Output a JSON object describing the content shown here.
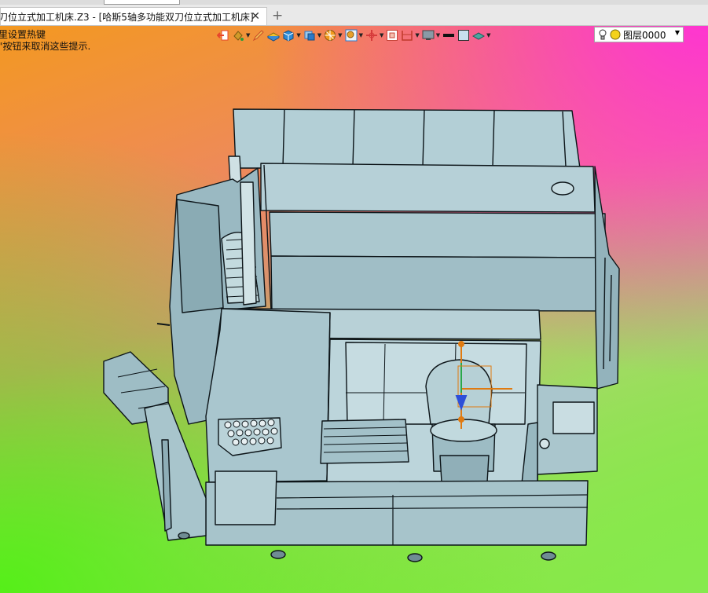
{
  "tab": {
    "title": "刀位立式加工机床.Z3 - [哈斯5轴多功能双刀位立式加工机床]",
    "close_icon": "close-icon",
    "new_tab_icon": "plus-icon"
  },
  "hint": {
    "line1": "里设置热键",
    "line2": "\"按钮来取消这些提示."
  },
  "toolbar": {
    "items": [
      {
        "icon": "exit-icon",
        "color": "#e8452c"
      },
      {
        "icon": "paint-bucket-icon",
        "color": "#d19a2a"
      },
      {
        "icon": "pencil-icon",
        "color": "#c84b2a"
      },
      {
        "icon": "flat-shade-icon",
        "color": "#f2c12e"
      },
      {
        "icon": "shaded-cube-icon",
        "color": "#2d8bd6"
      },
      {
        "icon": "view-cube-icon",
        "color": "#2b79c9"
      },
      {
        "icon": "render-mode-icon",
        "color": "#f29a1c"
      },
      {
        "icon": "zoom-icon",
        "color": "#e8a12c"
      },
      {
        "icon": "axis-icon",
        "color": "#d63b3b"
      },
      {
        "icon": "fit-view-icon",
        "color": "#c8463a"
      },
      {
        "icon": "section-view-icon",
        "color": "#c0392b"
      },
      {
        "icon": "display-icon",
        "color": "#6a6a6a"
      },
      {
        "icon": "line-color-icon",
        "color": "#111111"
      },
      {
        "icon": "fill-color-icon",
        "color": "#c9dff0"
      },
      {
        "icon": "material-icon",
        "color": "#4aa6a0"
      }
    ]
  },
  "layer": {
    "bulb_icon": "bulb-icon",
    "status_icon": "layer-on-icon",
    "label": "图层0000",
    "dropdown_icon": "chevron-down-icon"
  },
  "colors": {
    "machine_body": "#a6c4cc",
    "machine_edge": "#0c1418",
    "axis_orange": "#e07a10",
    "axis_blue": "#2e4fd8"
  }
}
